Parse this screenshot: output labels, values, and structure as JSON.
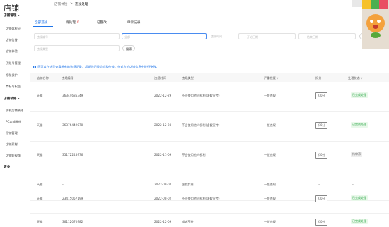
{
  "app": {
    "logo": "店铺"
  },
  "sidebar": {
    "sections": [
      {
        "label": "店铺管理",
        "items": [
          "店铺体检分",
          "店铺信誉",
          "店铺体验",
          "子账号管理",
          "隐私保护",
          "商标与权益"
        ]
      },
      {
        "label": "店铺装修",
        "items": [
          "手机店铺装修",
          "PC店铺装修",
          "旺铺管理",
          "店铺素材",
          "店铺短视频"
        ]
      },
      {
        "label": "更多",
        "items": []
      }
    ]
  },
  "breadcrumb": {
    "parent": "店铺体检",
    "separator": ">",
    "current": "违规处理"
  },
  "tabs": [
    {
      "label": "全部违规",
      "count": ""
    },
    {
      "label": "待处理",
      "count": "0"
    },
    {
      "label": "已整改",
      "count": ""
    },
    {
      "label": "申诉记录",
      "count": ""
    }
  ],
  "filters": {
    "violation_no": {
      "placeholder": "违规编号"
    },
    "status_select": {
      "placeholder": "全部"
    },
    "date_label": "违规时间",
    "start_date": {
      "placeholder": "开始日期"
    },
    "end_date": {
      "placeholder": "结束日期"
    },
    "expand_label": "展开",
    "export_label": "导出",
    "violation_type": {
      "placeholder": "违规类型"
    },
    "search_label": "搜索"
  },
  "notice": "您可以在这里查看所有的违规记录，超期的记录会自动失效，在对应的店铺信息中进行整改。",
  "table": {
    "headers": {
      "store": "店铺名称",
      "no": "违规编号",
      "time": "违规时间",
      "type": "违规类型",
      "severity": "严重程度",
      "deduct": "扣分",
      "status": "处理状态"
    },
    "rows": [
      {
        "store": "天猫",
        "no": "36344685349",
        "time": "2022-12-29",
        "type": "不当使用他人权利(虚假宣传)",
        "severity": "一般违规",
        "deduct": "扣0分",
        "status": "已完成处理",
        "status_kind": "ok"
      },
      {
        "store": "天猫",
        "no": "36376449070",
        "time": "2022-12-23",
        "type": "不当使用他人权利(虚假宣传)",
        "severity": "一般违规",
        "deduct": "扣0分",
        "status": "已完成处理",
        "status_kind": "ok"
      },
      {
        "store": "天猫",
        "no": "35172245976",
        "time": "2022-11-09",
        "type": "不当使用他人权利",
        "severity": "一般违规",
        "deduct": "扣0分",
        "status": "待申诉",
        "status_kind": "wait"
      },
      {
        "store": "天猫",
        "no": "--",
        "time": "2022-08-04",
        "type": "虚假交易",
        "severity": "一般违规",
        "deduct": "--",
        "status": "--",
        "status_kind": "none"
      },
      {
        "store": "天猫",
        "no": "23415057199",
        "time": "2022-08-02",
        "type": "不当使用他人权利(虚假宣传)",
        "severity": "一般违规",
        "deduct": "扣0分",
        "status": "已完成处理",
        "status_kind": "ok"
      },
      {
        "store": "天猫",
        "no": "36112070982",
        "time": "2022-12-09",
        "type": "描述不符",
        "severity": "一般违规",
        "deduct": "扣0分",
        "status": "已完成处理",
        "status_kind": "ok"
      }
    ]
  },
  "colors": {
    "accent": "#1e74e8",
    "success": "#2fa84a",
    "badge": "#e53935"
  }
}
